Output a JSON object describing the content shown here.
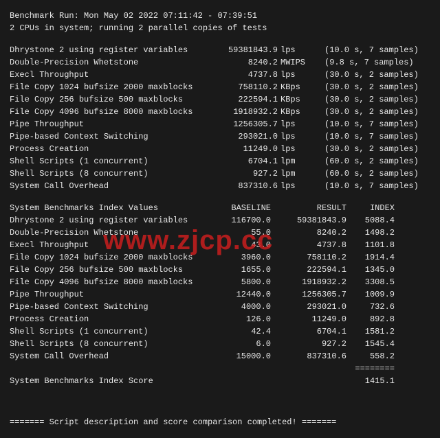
{
  "header": {
    "line1": "Benchmark Run: Mon May 02 2022 07:11:42 - 07:39:51",
    "line2": "2 CPUs in system; running 2 parallel copies of tests"
  },
  "results": [
    {
      "name": "Dhrystone 2 using register variables",
      "value": "59381843.9",
      "unit": "lps",
      "paren": "(10.0 s, 7 samples)"
    },
    {
      "name": "Double-Precision Whetstone",
      "value": "8240.2",
      "unit": "MWIPS",
      "paren": "(9.8 s, 7 samples)"
    },
    {
      "name": "Execl Throughput",
      "value": "4737.8",
      "unit": "lps",
      "paren": "(30.0 s, 2 samples)"
    },
    {
      "name": "File Copy 1024 bufsize 2000 maxblocks",
      "value": "758110.2",
      "unit": "KBps",
      "paren": "(30.0 s, 2 samples)"
    },
    {
      "name": "File Copy 256 bufsize 500 maxblocks",
      "value": "222594.1",
      "unit": "KBps",
      "paren": "(30.0 s, 2 samples)"
    },
    {
      "name": "File Copy 4096 bufsize 8000 maxblocks",
      "value": "1918932.2",
      "unit": "KBps",
      "paren": "(30.0 s, 2 samples)"
    },
    {
      "name": "Pipe Throughput",
      "value": "1256305.7",
      "unit": "lps",
      "paren": "(10.0 s, 7 samples)"
    },
    {
      "name": "Pipe-based Context Switching",
      "value": "293021.0",
      "unit": "lps",
      "paren": "(10.0 s, 7 samples)"
    },
    {
      "name": "Process Creation",
      "value": "11249.0",
      "unit": "lps",
      "paren": "(30.0 s, 2 samples)"
    },
    {
      "name": "Shell Scripts (1 concurrent)",
      "value": "6704.1",
      "unit": "lpm",
      "paren": "(60.0 s, 2 samples)"
    },
    {
      "name": "Shell Scripts (8 concurrent)",
      "value": "927.2",
      "unit": "lpm",
      "paren": "(60.0 s, 2 samples)"
    },
    {
      "name": "System Call Overhead",
      "value": "837310.6",
      "unit": "lps",
      "paren": "(10.0 s, 7 samples)"
    }
  ],
  "index_hdr": {
    "title": "System Benchmarks Index Values",
    "baseline": "BASELINE",
    "result": "RESULT",
    "index": "INDEX"
  },
  "index": [
    {
      "name": "Dhrystone 2 using register variables",
      "baseline": "116700.0",
      "result": "59381843.9",
      "index": "5088.4"
    },
    {
      "name": "Double-Precision Whetstone",
      "baseline": "55.0",
      "result": "8240.2",
      "index": "1498.2"
    },
    {
      "name": "Execl Throughput",
      "baseline": "43.0",
      "result": "4737.8",
      "index": "1101.8"
    },
    {
      "name": "File Copy 1024 bufsize 2000 maxblocks",
      "baseline": "3960.0",
      "result": "758110.2",
      "index": "1914.4"
    },
    {
      "name": "File Copy 256 bufsize 500 maxblocks",
      "baseline": "1655.0",
      "result": "222594.1",
      "index": "1345.0"
    },
    {
      "name": "File Copy 4096 bufsize 8000 maxblocks",
      "baseline": "5800.0",
      "result": "1918932.2",
      "index": "3308.5"
    },
    {
      "name": "Pipe Throughput",
      "baseline": "12440.0",
      "result": "1256305.7",
      "index": "1009.9"
    },
    {
      "name": "Pipe-based Context Switching",
      "baseline": "4000.0",
      "result": "293021.0",
      "index": "732.6"
    },
    {
      "name": "Process Creation",
      "baseline": "126.0",
      "result": "11249.0",
      "index": "892.8"
    },
    {
      "name": "Shell Scripts (1 concurrent)",
      "baseline": "42.4",
      "result": "6704.1",
      "index": "1581.2"
    },
    {
      "name": "Shell Scripts (8 concurrent)",
      "baseline": "6.0",
      "result": "927.2",
      "index": "1545.4"
    },
    {
      "name": "System Call Overhead",
      "baseline": "15000.0",
      "result": "837310.6",
      "index": "558.2"
    }
  ],
  "score": {
    "label": "System Benchmarks Index Score",
    "value": "1415.1",
    "sep": "========"
  },
  "footer": "======= Script description and score comparison completed! =======",
  "watermark": "www.zjcp.cc"
}
